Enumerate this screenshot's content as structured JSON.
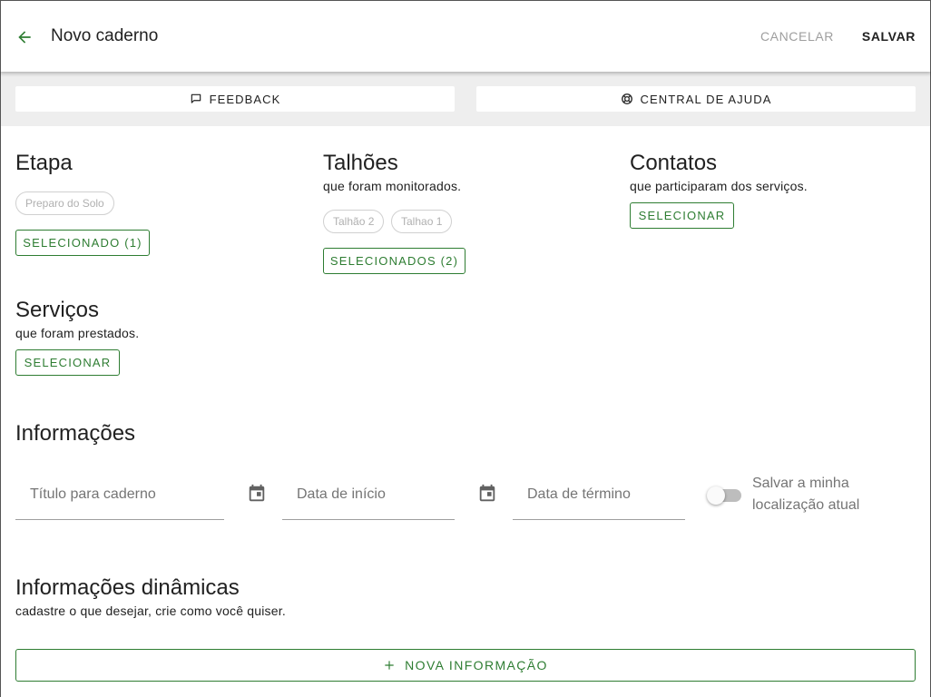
{
  "header": {
    "title": "Novo caderno",
    "back_icon": "arrow-left-icon",
    "cancel_label": "CANCELAR",
    "save_label": "SALVAR"
  },
  "help_strip": {
    "feedback_label": "FEEDBACK",
    "help_center_label": "CENTRAL DE AJUDA"
  },
  "sections": {
    "etapa": {
      "title": "Etapa",
      "chips": [
        "Preparo do Solo"
      ],
      "button_label": "SELECIONADO (1)"
    },
    "talhoes": {
      "title": "Talhões",
      "subtitle": "que foram monitorados.",
      "chips": [
        "Talhão 2",
        "Talhao 1"
      ],
      "button_label": "SELECIONADOS (2)"
    },
    "contatos": {
      "title": "Contatos",
      "subtitle": "que participaram dos serviços.",
      "button_label": "SELECIONAR"
    },
    "servicos": {
      "title": "Serviços",
      "subtitle": "que foram prestados.",
      "button_label": "SELECIONAR"
    }
  },
  "informacoes": {
    "title": "Informações",
    "title_field_label": "Título para caderno",
    "start_date_label": "Data de início",
    "end_date_label": "Data de término",
    "location_toggle_label": "Salvar a minha localização atual",
    "location_toggle_on": false
  },
  "dinamicas": {
    "title": "Informações dinâmicas",
    "subtitle": "cadastre o que desejar, crie como você quiser.",
    "add_button_label": "NOVA INFORMAÇÃO"
  },
  "colors": {
    "accent": "#2e7d32",
    "strip_background": "#eeeeee"
  }
}
